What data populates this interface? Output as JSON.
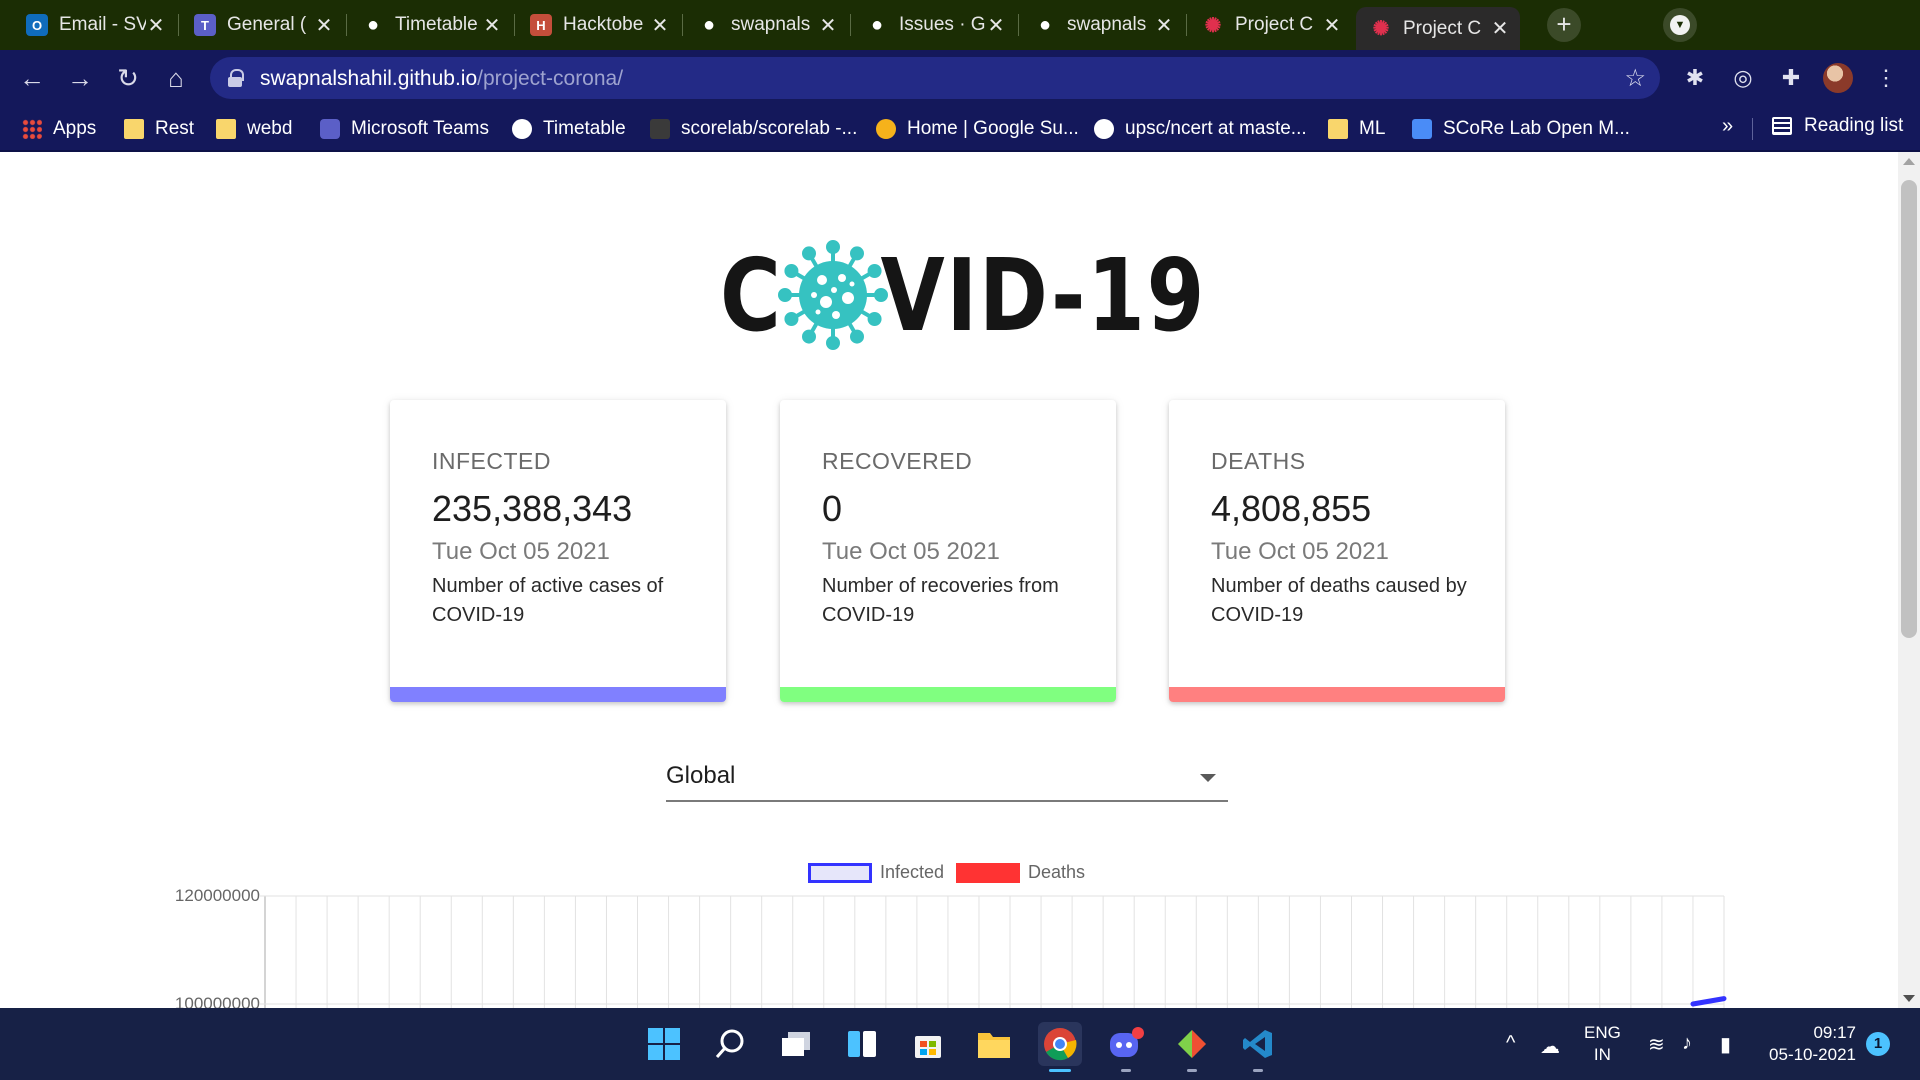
{
  "browser": {
    "tabs": [
      {
        "title": "Email - SV",
        "icon": "outlook-icon",
        "color": "#0f6cbd"
      },
      {
        "title": "General (",
        "icon": "teams-icon",
        "color": "#5b5fc7"
      },
      {
        "title": "Timetable",
        "icon": "globe-icon",
        "color": "#ffffff"
      },
      {
        "title": "Hacktobe",
        "icon": "hacktoberfest-icon",
        "color": "#c44e3b"
      },
      {
        "title": "swapnals",
        "icon": "github-icon",
        "color": "#ffffff"
      },
      {
        "title": "Issues · G",
        "icon": "github-icon",
        "color": "#ffffff"
      },
      {
        "title": "swapnals",
        "icon": "github-icon",
        "color": "#ffffff"
      },
      {
        "title": "Project C",
        "icon": "virus-icon",
        "color": "#e0304e"
      },
      {
        "title": "Project C",
        "icon": "virus-icon",
        "color": "#e0304e",
        "active": true
      }
    ],
    "url_host": "swapnalshahil.github.io",
    "url_path": "/project-corona/",
    "bookmarks": [
      {
        "label": "Apps",
        "icon": "apps"
      },
      {
        "label": "Rest",
        "icon": "folder"
      },
      {
        "label": "webd",
        "icon": "folder"
      },
      {
        "label": "Microsoft Teams",
        "icon": "teams"
      },
      {
        "label": "Timetable",
        "icon": "globe"
      },
      {
        "label": "scorelab/scorelab -...",
        "icon": "scorelab"
      },
      {
        "label": "Home | Google Su...",
        "icon": "gsun"
      },
      {
        "label": "upsc/ncert at maste...",
        "icon": "github"
      },
      {
        "label": "ML",
        "icon": "folder"
      },
      {
        "label": "SCoRe Lab Open M...",
        "icon": "doc"
      }
    ],
    "bookmarks_overflow": "»",
    "reading_list": "Reading list"
  },
  "page": {
    "logo": {
      "text_left": "C",
      "text_right": "VID-19",
      "virus_color": "#36c2c1"
    },
    "cards": [
      {
        "label": "INFECTED",
        "value": "235,388,343",
        "date": "Tue Oct 05 2021",
        "desc": "Number of active cases of COVID-19",
        "color": "#8080ff"
      },
      {
        "label": "RECOVERED",
        "value": "0",
        "date": "Tue Oct 05 2021",
        "desc": "Number of recoveries from COVID-19",
        "color": "#80ff80"
      },
      {
        "label": "DEATHS",
        "value": "4,808,855",
        "date": "Tue Oct 05 2021",
        "desc": "Number of deaths caused by COVID-19",
        "color": "#ff8080"
      }
    ],
    "country_select": {
      "selected": "Global"
    }
  },
  "chart_data": {
    "type": "line",
    "legend": [
      {
        "name": "Infected",
        "border": "#3333ff",
        "fill": "#e6e6fa"
      },
      {
        "name": "Deaths",
        "border": "#ff3333",
        "fill": "#ff3333"
      }
    ],
    "y_ticks": [
      120000000,
      100000000
    ],
    "ylim": [
      100000000,
      120000000
    ],
    "grid": true,
    "vertical_gridlines": 47,
    "series": [
      {
        "name": "Infected",
        "color": "#3333ff",
        "visible_points": [
          {
            "xi": 46.0,
            "y": 100000000
          },
          {
            "xi": 47.0,
            "y": 101000000
          }
        ]
      }
    ]
  },
  "taskbar": {
    "apps": [
      "start-icon",
      "search-icon",
      "task-view-icon",
      "widgets-icon",
      "store-icon",
      "file-explorer-icon",
      "chrome-icon",
      "discord-icon",
      "git-icon",
      "vscode-icon"
    ],
    "active_app": "chrome-icon",
    "lang_top": "ENG",
    "lang_bottom": "IN",
    "time": "09:17",
    "date": "05-10-2021",
    "notifications": "1"
  }
}
